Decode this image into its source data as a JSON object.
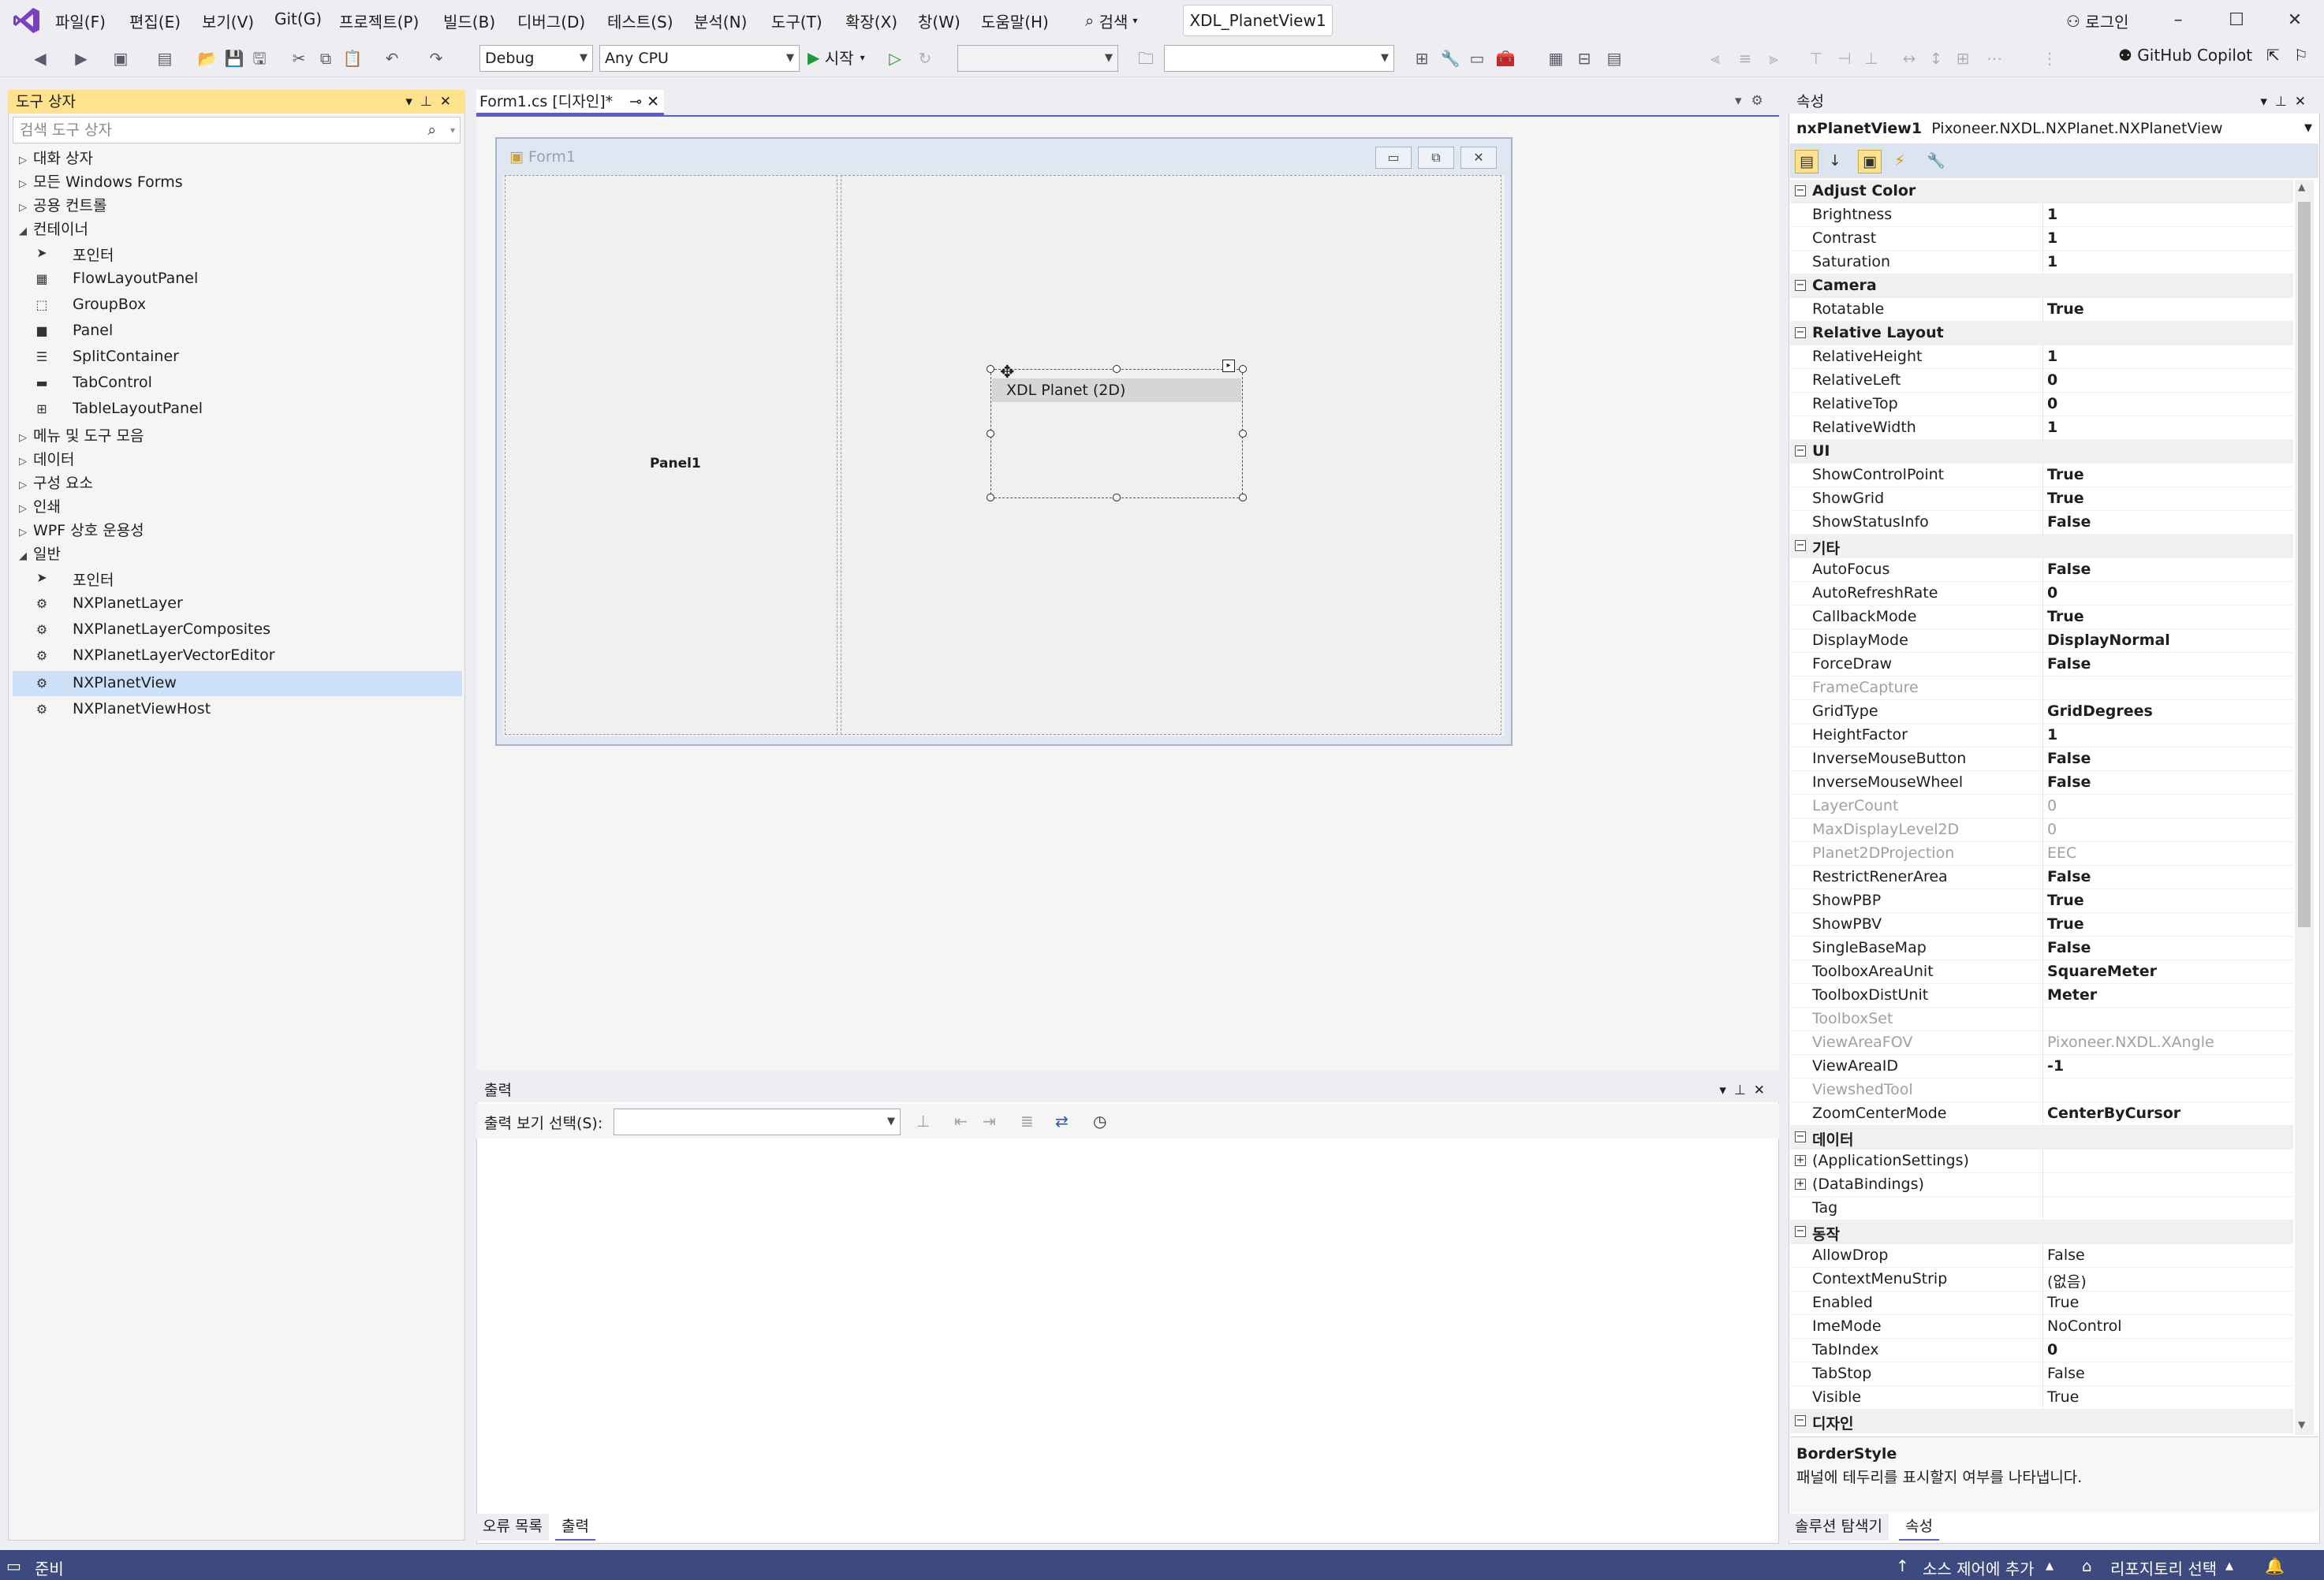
{
  "menu": {
    "items": [
      "파일(F)",
      "편집(E)",
      "보기(V)",
      "Git(G)",
      "프로젝트(P)",
      "빌드(B)",
      "디버그(D)",
      "테스트(S)",
      "분석(N)",
      "도구(T)",
      "확장(X)",
      "창(W)",
      "도움말(H)"
    ],
    "search": "검색",
    "solution": "XDL_PlanetView1",
    "login": "로그인"
  },
  "toolbar": {
    "config": "Debug",
    "platform": "Any CPU",
    "start": "시작",
    "copilot": "GitHub Copilot"
  },
  "toolbox": {
    "title": "도구 상자",
    "search_placeholder": "검색 도구 상자",
    "groups": [
      {
        "label": "대화 상자",
        "expanded": false
      },
      {
        "label": "모든 Windows Forms",
        "expanded": false
      },
      {
        "label": "공용 컨트롤",
        "expanded": false
      },
      {
        "label": "컨테이너",
        "expanded": true
      },
      {
        "label": "메뉴 및 도구 모음",
        "expanded": false
      },
      {
        "label": "데이터",
        "expanded": false
      },
      {
        "label": "구성 요소",
        "expanded": false
      },
      {
        "label": "인쇄",
        "expanded": false
      },
      {
        "label": "WPF 상호 운용성",
        "expanded": false
      },
      {
        "label": "일반",
        "expanded": true
      }
    ],
    "container_items": [
      "포인터",
      "FlowLayoutPanel",
      "GroupBox",
      "Panel",
      "SplitContainer",
      "TabControl",
      "TableLayoutPanel"
    ],
    "general_items": [
      "포인터",
      "NXPlanetLayer",
      "NXPlanetLayerComposites",
      "NXPlanetLayerVectorEditor",
      "NXPlanetView",
      "NXPlanetViewHost"
    ],
    "selected": "NXPlanetView"
  },
  "designer": {
    "tab": "Form1.cs [디자인]*",
    "form_title": "Form1",
    "panel1": "Panel1",
    "planet_label": "XDL Planet (2D)"
  },
  "output": {
    "title": "출력",
    "label": "출력 보기 선택(S):",
    "tabs": [
      "오류 목록",
      "출력"
    ]
  },
  "properties": {
    "title": "속성",
    "object_name": "nxPlanetView1",
    "object_type": "Pixoneer.NXDL.NXPlanet.NXPlanetView",
    "rows": [
      {
        "cat": "Adjust Color"
      },
      {
        "n": "Brightness",
        "v": "1",
        "b": true
      },
      {
        "n": "Contrast",
        "v": "1",
        "b": true
      },
      {
        "n": "Saturation",
        "v": "1",
        "b": true
      },
      {
        "cat": "Camera"
      },
      {
        "n": "Rotatable",
        "v": "True",
        "b": true
      },
      {
        "cat": "Relative Layout"
      },
      {
        "n": "RelativeHeight",
        "v": "1",
        "b": true
      },
      {
        "n": "RelativeLeft",
        "v": "0",
        "b": true
      },
      {
        "n": "RelativeTop",
        "v": "0",
        "b": true
      },
      {
        "n": "RelativeWidth",
        "v": "1",
        "b": true
      },
      {
        "cat": "UI"
      },
      {
        "n": "ShowControlPoint",
        "v": "True",
        "b": true
      },
      {
        "n": "ShowGrid",
        "v": "True",
        "b": true
      },
      {
        "n": "ShowStatusInfo",
        "v": "False",
        "b": true
      },
      {
        "cat": "기타"
      },
      {
        "n": "AutoFocus",
        "v": "False",
        "b": true
      },
      {
        "n": "AutoRefreshRate",
        "v": "0",
        "b": true
      },
      {
        "n": "CallbackMode",
        "v": "True",
        "b": true
      },
      {
        "n": "DisplayMode",
        "v": "DisplayNormal",
        "b": true
      },
      {
        "n": "ForceDraw",
        "v": "False",
        "b": true
      },
      {
        "n": "FrameCapture",
        "v": "",
        "d": true
      },
      {
        "n": "GridType",
        "v": "GridDegrees",
        "b": true
      },
      {
        "n": "HeightFactor",
        "v": "1",
        "b": true
      },
      {
        "n": "InverseMouseButton",
        "v": "False",
        "b": true
      },
      {
        "n": "InverseMouseWheel",
        "v": "False",
        "b": true
      },
      {
        "n": "LayerCount",
        "v": "0",
        "d": true
      },
      {
        "n": "MaxDisplayLevel2D",
        "v": "0",
        "d": true
      },
      {
        "n": "Planet2DProjection",
        "v": "EEC",
        "d": true
      },
      {
        "n": "RestrictRenerArea",
        "v": "False",
        "b": true
      },
      {
        "n": "ShowPBP",
        "v": "True",
        "b": true
      },
      {
        "n": "ShowPBV",
        "v": "True",
        "b": true
      },
      {
        "n": "SingleBaseMap",
        "v": "False",
        "b": true
      },
      {
        "n": "ToolboxAreaUnit",
        "v": "SquareMeter",
        "b": true
      },
      {
        "n": "ToolboxDistUnit",
        "v": "Meter",
        "b": true
      },
      {
        "n": "ToolboxSet",
        "v": "",
        "d": true
      },
      {
        "n": "ViewAreaFOV",
        "v": "Pixoneer.NXDL.XAngle",
        "d": true
      },
      {
        "n": "ViewAreaID",
        "v": "-1",
        "b": true
      },
      {
        "n": "ViewshedTool",
        "v": "",
        "d": true
      },
      {
        "n": "ZoomCenterMode",
        "v": "CenterByCursor",
        "b": true
      },
      {
        "cat": "데이터"
      },
      {
        "n": "(ApplicationSettings)",
        "v": "",
        "exp": true
      },
      {
        "n": "(DataBindings)",
        "v": "",
        "exp": true
      },
      {
        "n": "Tag",
        "v": ""
      },
      {
        "cat": "동작"
      },
      {
        "n": "AllowDrop",
        "v": "False"
      },
      {
        "n": "ContextMenuStrip",
        "v": "(없음)"
      },
      {
        "n": "Enabled",
        "v": "True"
      },
      {
        "n": "ImeMode",
        "v": "NoControl"
      },
      {
        "n": "TabIndex",
        "v": "0",
        "b": true
      },
      {
        "n": "TabStop",
        "v": "False"
      },
      {
        "n": "Visible",
        "v": "True"
      },
      {
        "cat": "디자인"
      }
    ],
    "desc_title": "BorderStyle",
    "desc_text": "패널에 테두리를 표시할지 여부를 나타냅니다.",
    "tabs": [
      "솔루션 탐색기",
      "속성"
    ]
  },
  "status": {
    "ready": "준비",
    "source_control": "소스 제어에 추가",
    "repo": "리포지토리 선택"
  },
  "colors": {
    "accent": "#5b5be0",
    "toolbox_header": "#ffe28c",
    "status_bar": "#3c4a80",
    "selection": "#cce0f8"
  }
}
